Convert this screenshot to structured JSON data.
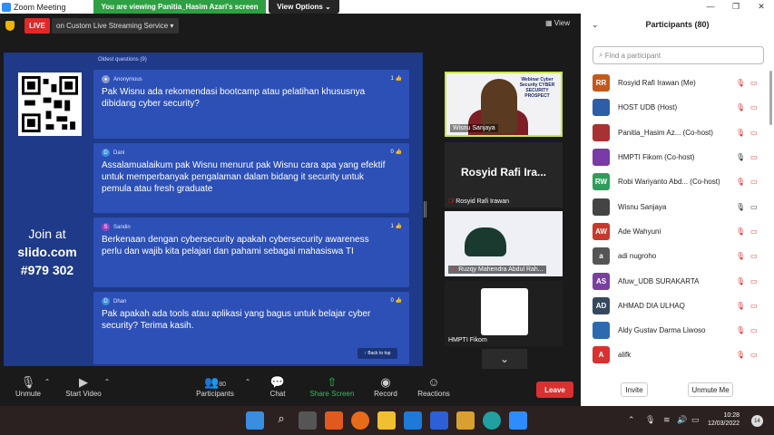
{
  "window": {
    "title": "Zoom Meeting"
  },
  "banner": {
    "viewing": "You are viewing Panitia_Hasim Azari's screen",
    "view_options": "View Options ⌄"
  },
  "top": {
    "live": "LIVE",
    "live_service": "on Custom Live Streaming Service ▾",
    "view": "View"
  },
  "slido": {
    "join_line1": "Join at",
    "join_line2": "slido.com",
    "join_code": "#979 302",
    "oldest": "Oldest questions (9)",
    "back_to_top": "↑ Back to top",
    "questions": [
      {
        "author": "Anonymous",
        "initial": "",
        "likes": "1",
        "text": "Pak Wisnu ada rekomendasi bootcamp atau pelatihan khususnya dibidang cyber security?"
      },
      {
        "author": "Dani",
        "initial": "D",
        "likes": "0",
        "text": "Assalamualaikum pak Wisnu menurut pak Wisnu cara apa yang efektif untuk memperbanyak pengalaman dalam bidang it security untuk pemula atau fresh graduate"
      },
      {
        "author": "Sandin",
        "initial": "S",
        "likes": "1",
        "text": "Berkenaan dengan cybersecurity apakah cybersecurity awareness perlu dan wajib kita pelajari dan pahami sebagai mahasiswa TI"
      },
      {
        "author": "Dhan",
        "initial": "D",
        "likes": "0",
        "text": "Pak apakah ada tools atau aplikasi yang bagus untuk belajar cyber security? Terima kasih."
      }
    ]
  },
  "videos": {
    "tile1": {
      "name": "Wisnu Sanjaya",
      "caption": "Webinar Cyber Security CYBER SECURITY PROSPECT"
    },
    "tile2": {
      "name": "Rosyid Rafi Irawan",
      "big": "Rosyid Rafi Ira..."
    },
    "tile3": {
      "name": "Ruzqy Mahendra Abdul Rah..."
    },
    "tile4": {
      "name": "HMPTI Fikom"
    }
  },
  "toolbar": {
    "unmute": "Unmute",
    "start_video": "Start Video",
    "participants": "Participants",
    "participants_count": "80",
    "chat": "Chat",
    "share_screen": "Share Screen",
    "record": "Record",
    "reactions": "Reactions",
    "leave": "Leave"
  },
  "panel": {
    "title": "Participants (80)",
    "search_placeholder": "Find a participant",
    "invite": "Invite",
    "unmute_me": "Unmute Me",
    "participants": [
      {
        "initials": "RR",
        "color": "#c4581a",
        "name": "Rosyid Rafi Irawan (Me)",
        "mic": "muted",
        "cam": "off"
      },
      {
        "initials": "",
        "color": "#2d5fa8",
        "name": "HOST UDB (Host)",
        "mic": "muted",
        "cam": "off"
      },
      {
        "initials": "",
        "color": "#a83232",
        "name": "Panitia_Hasim Az... (Co-host)",
        "mic": "muted",
        "cam": "off"
      },
      {
        "initials": "",
        "color": "#7a3aa8",
        "name": "HMPTI Fikom (Co-host)",
        "mic": "on",
        "cam": "off"
      },
      {
        "initials": "RW",
        "color": "#2e9e5a",
        "name": "Robi Wariyanto Abd... (Co-host)",
        "mic": "muted",
        "cam": "off"
      },
      {
        "initials": "",
        "color": "#444444",
        "name": "Wisnu Sanjaya",
        "mic": "on",
        "cam": "on"
      },
      {
        "initials": "AW",
        "color": "#c73a2a",
        "name": "Ade Wahyuni",
        "mic": "muted",
        "cam": "off"
      },
      {
        "initials": "a",
        "color": "#555555",
        "name": "adi nugroho",
        "mic": "muted",
        "cam": "off"
      },
      {
        "initials": "AS",
        "color": "#7b3fa0",
        "name": "Afuw_UDB SURAKARTA",
        "mic": "muted",
        "cam": "off"
      },
      {
        "initials": "AD",
        "color": "#34495e",
        "name": "AHMAD DIA ULHAQ",
        "mic": "muted",
        "cam": "off"
      },
      {
        "initials": "",
        "color": "#2d6bb0",
        "name": "Aldy Gustav Darma Liwoso",
        "mic": "muted",
        "cam": "off"
      },
      {
        "initials": "A",
        "color": "#d93030",
        "name": "alifk",
        "mic": "muted",
        "cam": "off"
      }
    ]
  },
  "taskbar": {
    "time": "10:28",
    "date": "12/03/2022",
    "notif": "14"
  }
}
